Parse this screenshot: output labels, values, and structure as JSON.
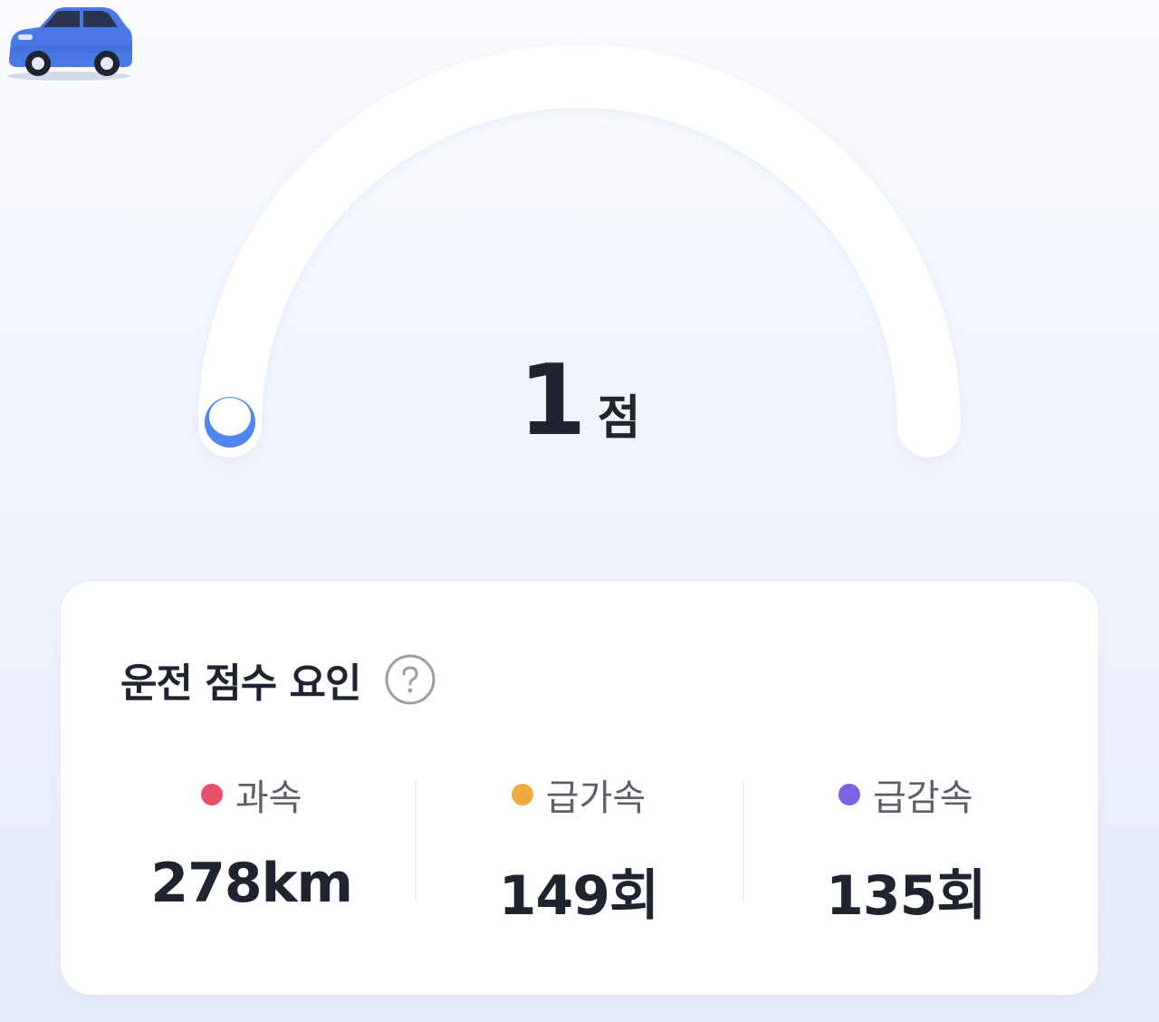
{
  "score": {
    "value": "1",
    "unit": "점",
    "max": 100,
    "icon": "car-icon",
    "accent_color": "#4f86f0"
  },
  "factors_card": {
    "title": "운전 점수 요인",
    "help_icon": "question-circle-icon",
    "items": [
      {
        "label": "과속",
        "value": "278km",
        "color": "#e8506a"
      },
      {
        "label": "급가속",
        "value": "149회",
        "color": "#f0a93c"
      },
      {
        "label": "급감속",
        "value": "135회",
        "color": "#7b62e2"
      }
    ]
  }
}
